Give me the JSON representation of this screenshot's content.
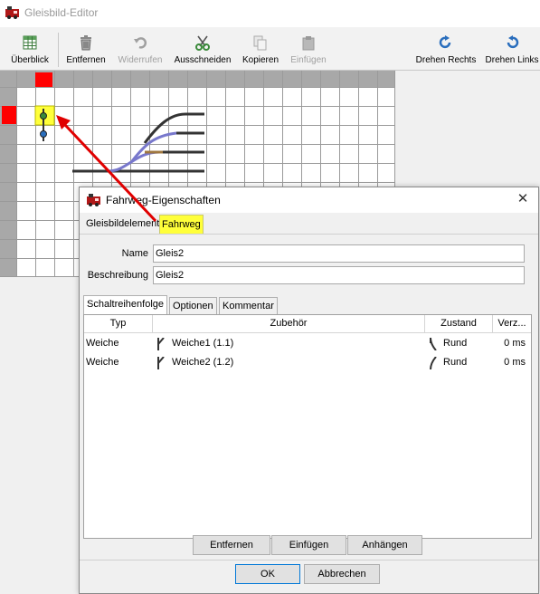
{
  "window": {
    "title": "Gleisbild-Editor"
  },
  "toolbar": {
    "items": [
      {
        "label": "Überblick",
        "icon": "table-grid-icon",
        "enabled": true
      },
      {
        "label": "Entfernen",
        "icon": "trash-icon",
        "enabled": true
      },
      {
        "label": "Widerrufen",
        "icon": "undo-icon",
        "enabled": false
      },
      {
        "label": "Ausschneiden",
        "icon": "scissors-icon",
        "enabled": true
      },
      {
        "label": "Kopieren",
        "icon": "copy-icon",
        "enabled": true
      },
      {
        "label": "Einfügen",
        "icon": "paste-icon",
        "enabled": false
      },
      {
        "label": "Drehen Rechts",
        "icon": "rotate-right-icon",
        "enabled": true
      },
      {
        "label": "Drehen Links",
        "icon": "rotate-left-icon",
        "enabled": true
      }
    ]
  },
  "colors": {
    "marker_red": "#ff0000",
    "highlight_yellow": "#ffff3a",
    "arrow_red": "#e00000",
    "track_dark": "#333333",
    "track_blue": "#7878cc",
    "track_brown": "#a07840",
    "icon_blue": "#2a6ebd",
    "icon_green": "#3a8a3a"
  },
  "dialog": {
    "title": "Fahrweg-Eigenschaften",
    "close_glyph": "✕",
    "tabs": [
      {
        "label": "Gleisbildelement",
        "active": false
      },
      {
        "label": "Fahrweg",
        "active": true,
        "highlighted": true
      }
    ],
    "fields": {
      "name_label": "Name",
      "name_value": "Gleis2",
      "description_label": "Beschreibung",
      "description_value": "Gleis2"
    },
    "sub_tabs": [
      {
        "label": "Schaltreihenfolge",
        "active": true
      },
      {
        "label": "Optionen",
        "active": false
      },
      {
        "label": "Kommentar",
        "active": false
      }
    ],
    "table": {
      "columns": [
        "Typ",
        "Zubehör",
        "Zustand",
        "Verz..."
      ],
      "rows": [
        {
          "typ": "Weiche",
          "zubehoer": "Weiche1 (1.1)",
          "zustand": "Rund",
          "verz": "0 ms"
        },
        {
          "typ": "Weiche",
          "zubehoer": "Weiche2 (1.2)",
          "zustand": "Rund",
          "verz": "0 ms"
        }
      ]
    },
    "table_buttons": [
      "Entfernen",
      "Einfügen",
      "Anhängen"
    ],
    "ok_label": "OK",
    "cancel_label": "Abbrechen"
  }
}
